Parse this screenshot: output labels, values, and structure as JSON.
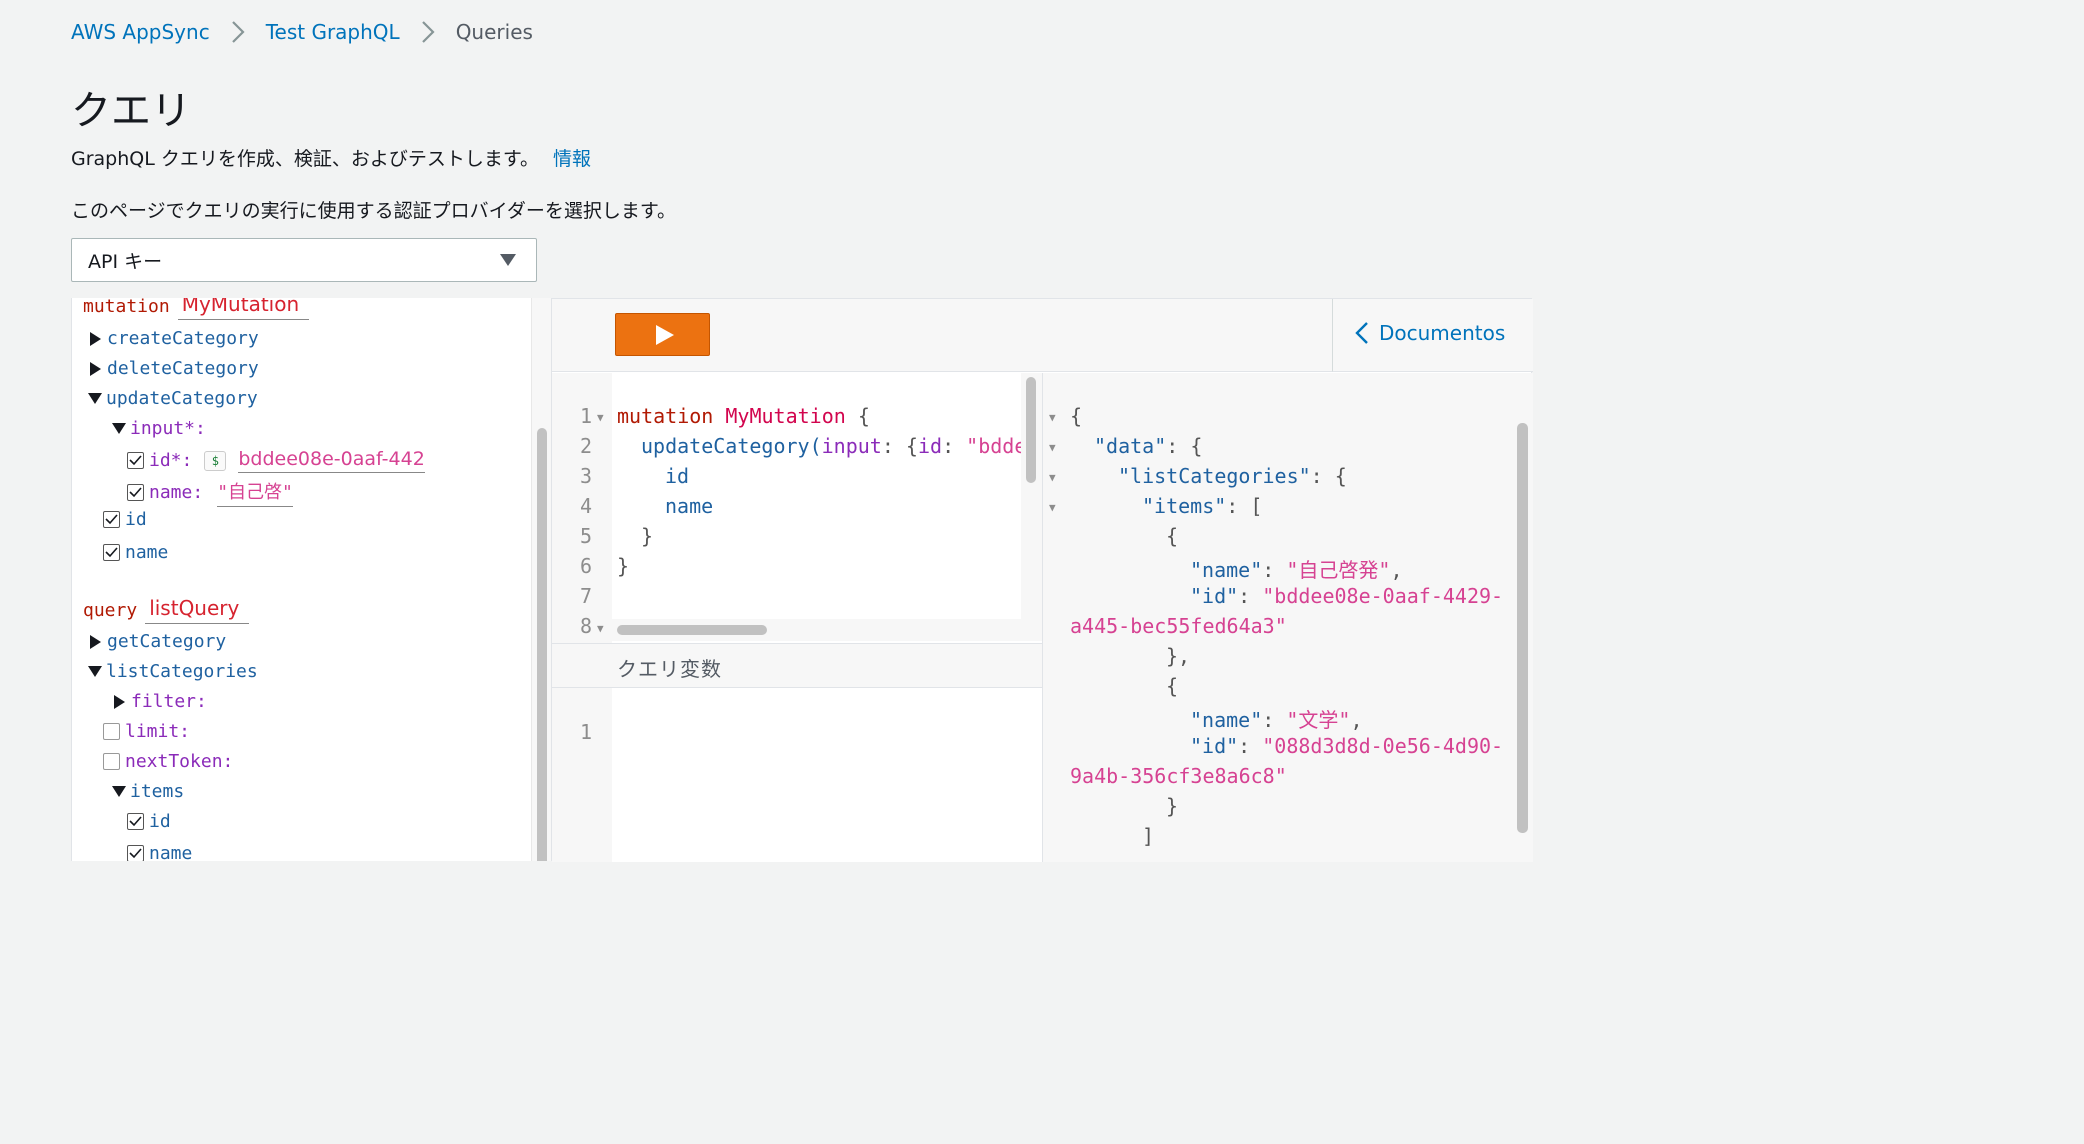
{
  "breadcrumb": {
    "items": [
      "AWS AppSync",
      "Test GraphQL",
      "Queries"
    ]
  },
  "header": {
    "title": "クエリ",
    "description": "GraphQL クエリを作成、検証、およびテストします。",
    "info_link": "情報",
    "provider_description": "このページでクエリの実行に使用する認証プロバイダーを選択します。"
  },
  "auth_select": {
    "value": "API キー"
  },
  "explorer": {
    "mutation": {
      "keyword": "mutation",
      "name": "MyMutation",
      "fields": [
        "createCategory",
        "deleteCategory",
        "updateCategory"
      ],
      "input_label": "input*:",
      "id_label": "id*:",
      "dollar": "$",
      "id_value": "bddee08e-0aaf-442",
      "name_label": "name:",
      "name_value": "\"自己啓\"",
      "sel_id": "id",
      "sel_name": "name"
    },
    "query": {
      "keyword": "query",
      "name": "listQuery",
      "fields": [
        "getCategory",
        "listCategories"
      ],
      "filter_label": "filter:",
      "limit_label": "limit:",
      "next_token_label": "nextToken:",
      "items_label": "items",
      "item_id": "id",
      "item_name": "name"
    }
  },
  "toolbar": {
    "run_button": "play-icon",
    "docs_label": "Documentos"
  },
  "query_editor": {
    "line_numbers": [
      "1",
      "2",
      "3",
      "4",
      "5",
      "6",
      "7",
      "8"
    ],
    "line1_kw": "mutation",
    "line1_name": "MyMutation",
    "line1_brace": "{",
    "line2_field": "updateCategory(",
    "line2_arg": "input",
    "line2_rest": ": {",
    "line2_id": "id",
    "line2_colon": ": ",
    "line2_str": "\"bdde",
    "line3": "id",
    "line4": "name",
    "line5": "}",
    "line6": "}"
  },
  "variables": {
    "header": "クエリ変数",
    "line_numbers": [
      "1"
    ]
  },
  "result": {
    "open": "{",
    "data_key": "\"data\"",
    "list_key": "\"listCategories\"",
    "items_key": "\"items\"",
    "bracket_open": "[",
    "obj_open": "{",
    "name_key": "\"name\"",
    "id_key": "\"id\"",
    "item1_name": "\"自己啓発\"",
    "item1_id_a": "\"bddee08e-0aaf-4429-",
    "item1_id_b": "a445-bec55fed64a3\"",
    "obj_close_comma": "},",
    "item2_name": "\"文学\"",
    "item2_id_a": "\"088d3d8d-0e56-4d90-",
    "item2_id_b": "9a4b-356cf3e8a6c8\"",
    "obj_close": "}",
    "bracket_close": "]"
  }
}
